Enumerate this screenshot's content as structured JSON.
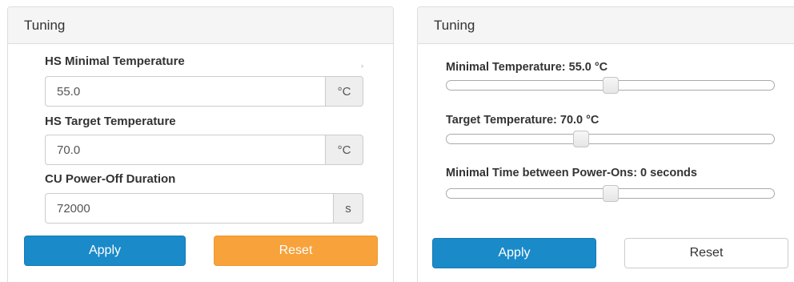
{
  "left_panel": {
    "title": "Tuning",
    "fields": [
      {
        "label": "HS Minimal Temperature",
        "value": "55.0",
        "unit": "°C"
      },
      {
        "label": "HS Target Temperature",
        "value": "70.0",
        "unit": "°C"
      },
      {
        "label": "CU Power-Off Duration",
        "value": "72000",
        "unit": "s"
      }
    ],
    "small_mark": "›",
    "apply_label": "Apply",
    "reset_label": "Reset"
  },
  "right_panel": {
    "title": "Tuning",
    "sliders": [
      {
        "label": "Minimal Temperature: 55.0 °C",
        "fraction": 0.5
      },
      {
        "label": "Target Temperature: 70.0 °C",
        "fraction": 0.41
      },
      {
        "label": "Minimal Time between Power-Ons: 0 seconds",
        "fraction": 0.5
      }
    ],
    "apply_label": "Apply",
    "reset_label": "Reset"
  },
  "colors": {
    "primary": "#1a8ac9",
    "warning": "#f7a23a",
    "panel_heading_bg": "#f5f5f5",
    "addon_bg": "#eeeeee"
  }
}
